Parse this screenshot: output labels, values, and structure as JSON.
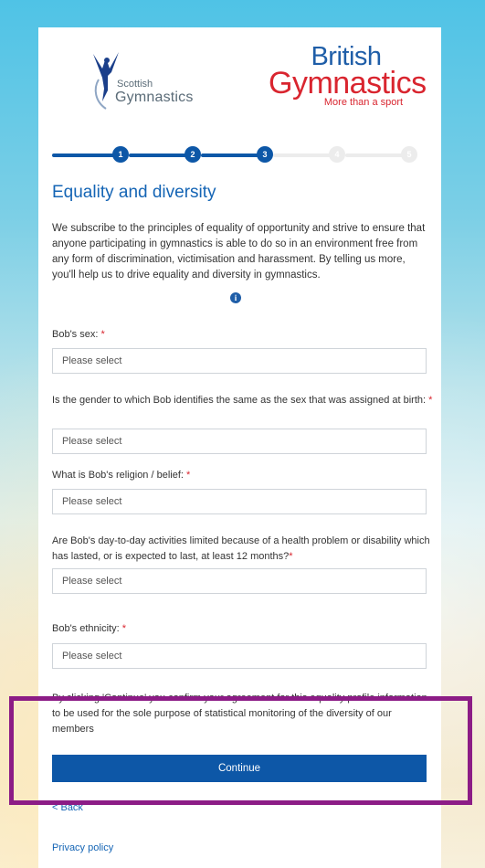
{
  "logos": {
    "scottish_small": "Scottish",
    "scottish_big": "Gymnastics",
    "british_line1": "British",
    "british_line2": "Gymnastics",
    "british_tagline": "More than a sport"
  },
  "stepper": {
    "steps": [
      "1",
      "2",
      "3",
      "4",
      "5"
    ],
    "current_step": 3
  },
  "page": {
    "title": "Equality and diversity",
    "intro": "We subscribe to the principles of equality of opportunity and strive to ensure that anyone participating in gymnastics is able to do so in an environment free from any form of discrimination, victimisation and harassment. By telling us more, you'll help us to drive equality and diversity in gymnastics."
  },
  "fields": [
    {
      "label": "Bob's sex:",
      "required_mark": "*",
      "value": "Please select"
    },
    {
      "label": "Is the gender to which Bob identifies the same as the sex that was assigned at birth:",
      "required_mark": "*",
      "value": "Please select"
    },
    {
      "label": "What is Bob's religion / belief:",
      "required_mark": "*",
      "value": "Please select"
    },
    {
      "label": "Are Bob's day-to-day activities limited because of a health problem or disability which has lasted, or is expected to last, at least 12 months?",
      "required_mark": "*",
      "value": "Please select"
    },
    {
      "label": "Bob's ethnicity:",
      "required_mark": "*",
      "value": "Please select"
    }
  ],
  "consent_text": "By clicking 'Continue' you confirm your agreement for this equality profile information to be used for the sole purpose of statistical monitoring of the diversity of our members",
  "buttons": {
    "continue": "Continue",
    "back": "< Back",
    "privacy": "Privacy policy"
  },
  "colors": {
    "primary": "#0d57a7",
    "heading": "#1565b5",
    "required": "#d9252f",
    "highlight": "#8c1c86",
    "british_blue": "#1f5ea8",
    "british_red": "#d9252f"
  },
  "icons": {
    "info": "info-icon"
  }
}
